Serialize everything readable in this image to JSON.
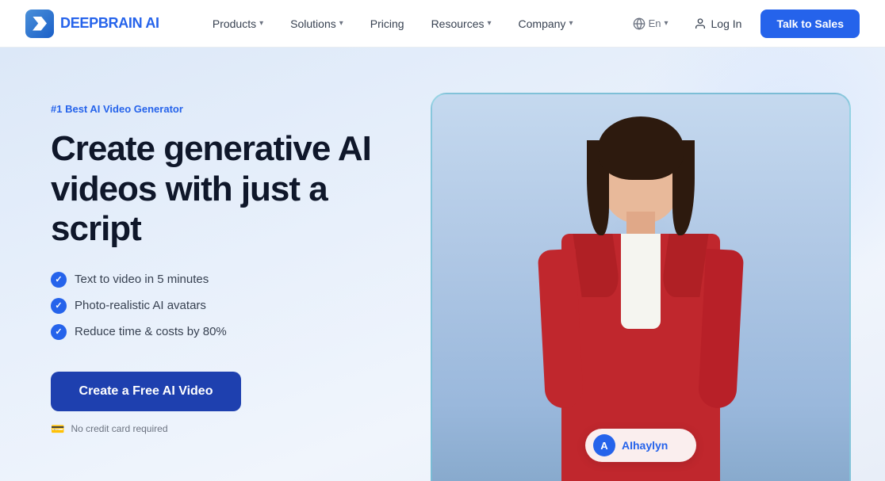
{
  "brand": {
    "name_part1": "DEEPBRAIN",
    "name_part2": " AI"
  },
  "nav": {
    "links": [
      {
        "label": "Products",
        "has_dropdown": true
      },
      {
        "label": "Solutions",
        "has_dropdown": true
      },
      {
        "label": "Pricing",
        "has_dropdown": false
      },
      {
        "label": "Resources",
        "has_dropdown": true
      },
      {
        "label": "Company",
        "has_dropdown": true
      }
    ],
    "lang": "En",
    "login_label": "Log In",
    "cta_label": "Talk to Sales"
  },
  "hero": {
    "badge": "#1 Best AI Video Generator",
    "title_line1": "Create generative AI",
    "title_line2": "videos with just a script",
    "features": [
      "Text to video in 5 minutes",
      "Photo-realistic AI avatars",
      "Reduce time & costs by 80%"
    ],
    "cta_button": "Create a Free AI Video",
    "no_cc_text": "No credit card required",
    "avatar_name_prefix": "AI",
    "avatar_name": "haylyn"
  }
}
